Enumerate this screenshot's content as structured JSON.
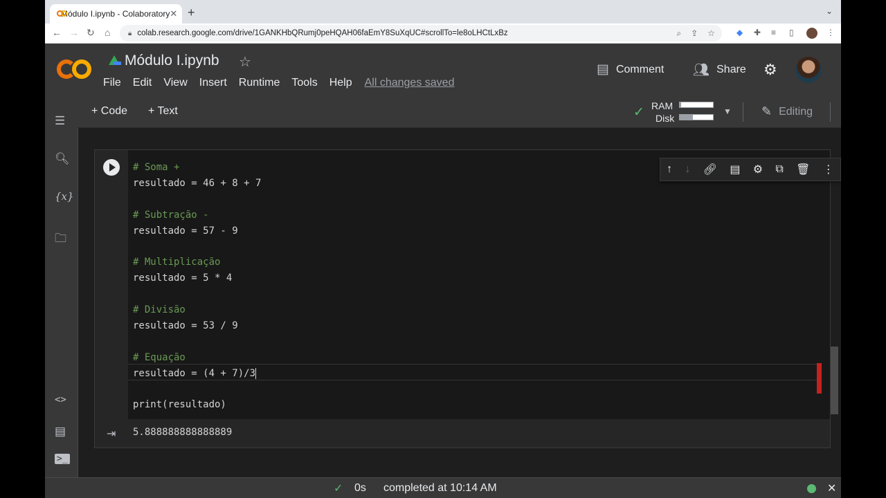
{
  "browser": {
    "tab_title": "Módulo I.ipynb - Colaboratory",
    "url": "colab.research.google.com/drive/1GANKHbQRumj0peHQAH06faEmY8SuXqUC#scrollTo=le8oLHCtLxBz"
  },
  "header": {
    "notebook_title": "Módulo I.ipynb",
    "menu": [
      "File",
      "Edit",
      "View",
      "Insert",
      "Runtime",
      "Tools",
      "Help"
    ],
    "save_status": "All changes saved",
    "comment_label": "Comment",
    "share_label": "Share"
  },
  "toolbar": {
    "add_code_label": "Code",
    "add_text_label": "Text",
    "ram_label": "RAM",
    "disk_label": "Disk",
    "ram_fraction": 0.05,
    "disk_fraction": 0.4,
    "editing_label": "Editing"
  },
  "cell": {
    "code_lines": [
      {
        "text": "# Soma +",
        "type": "comment"
      },
      {
        "text": "resultado = 46 + 8 + 7",
        "type": "code"
      },
      {
        "text": "",
        "type": "code"
      },
      {
        "text": "# Subtração -",
        "type": "comment"
      },
      {
        "text": "resultado = 57 - 9",
        "type": "code"
      },
      {
        "text": "",
        "type": "code"
      },
      {
        "text": "# Multiplicação",
        "type": "comment"
      },
      {
        "text": "resultado = 5 * 4",
        "type": "code"
      },
      {
        "text": "",
        "type": "code"
      },
      {
        "text": "# Divisão",
        "type": "comment"
      },
      {
        "text": "resultado = 53 / 9",
        "type": "code"
      },
      {
        "text": "",
        "type": "code"
      },
      {
        "text": "# Equação",
        "type": "comment"
      },
      {
        "text": "resultado = (4 + 7)/3",
        "type": "code",
        "cursor": true
      },
      {
        "text": "",
        "type": "code"
      },
      {
        "text": "print(resultado)",
        "type": "code"
      }
    ],
    "output": "5.888888888888889"
  },
  "status": {
    "duration": "0s",
    "completed": "completed at 10:14 AM"
  },
  "colors": {
    "comment": "#6a9955",
    "ok_green": "#5bb974",
    "error_red": "#c5221f"
  }
}
